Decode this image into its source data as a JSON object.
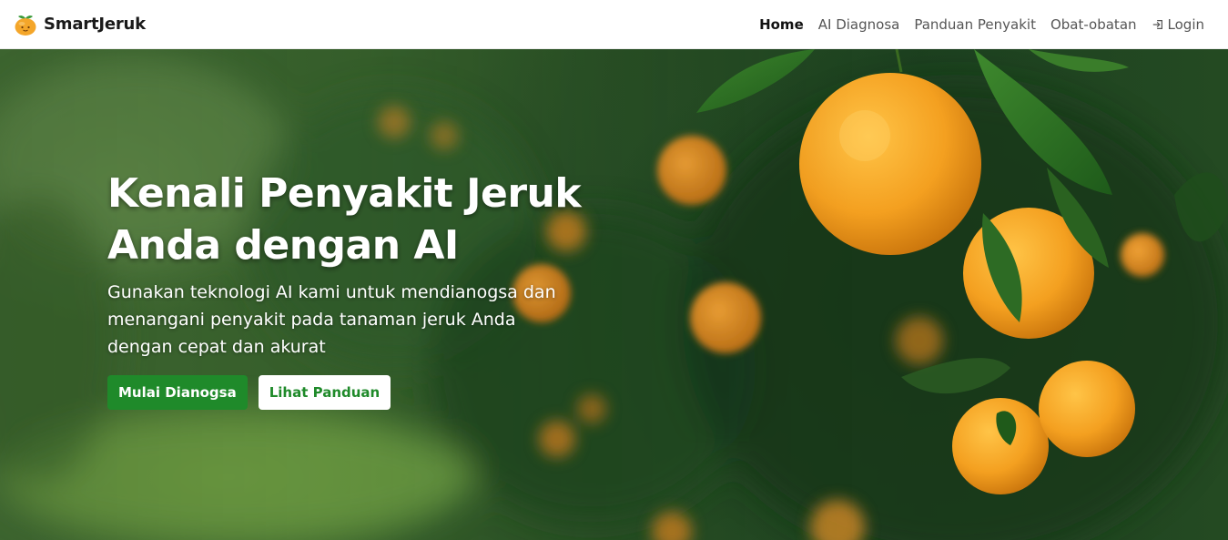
{
  "brand": {
    "name": "SmartJeruk",
    "logo_icon": "orange-fruit-icon"
  },
  "nav": {
    "items": [
      {
        "label": "Home",
        "active": true
      },
      {
        "label": "AI Diagnosa",
        "active": false
      },
      {
        "label": "Panduan Penyakit",
        "active": false
      },
      {
        "label": "Obat-obatan",
        "active": false
      }
    ],
    "login": {
      "label": "Login",
      "icon": "login-icon"
    }
  },
  "hero": {
    "title_line1": "Kenali Penyakit Jeruk",
    "title_line2": "Anda dengan AI",
    "subtitle_line1": "Gunakan teknologi AI kami untuk mendianogsa dan",
    "subtitle_line2": "menangani penyakit pada tanaman jeruk Anda",
    "subtitle_line3": "dengan cepat dan akurat",
    "primary_button": "Mulai Dianogsa",
    "secondary_button": "Lihat Panduan",
    "background": "orange-orchard-photo"
  },
  "colors": {
    "brand_green": "#1f8a2a",
    "orange": "#f2a21c",
    "nav_active": "#111111",
    "nav_text": "#555555"
  }
}
